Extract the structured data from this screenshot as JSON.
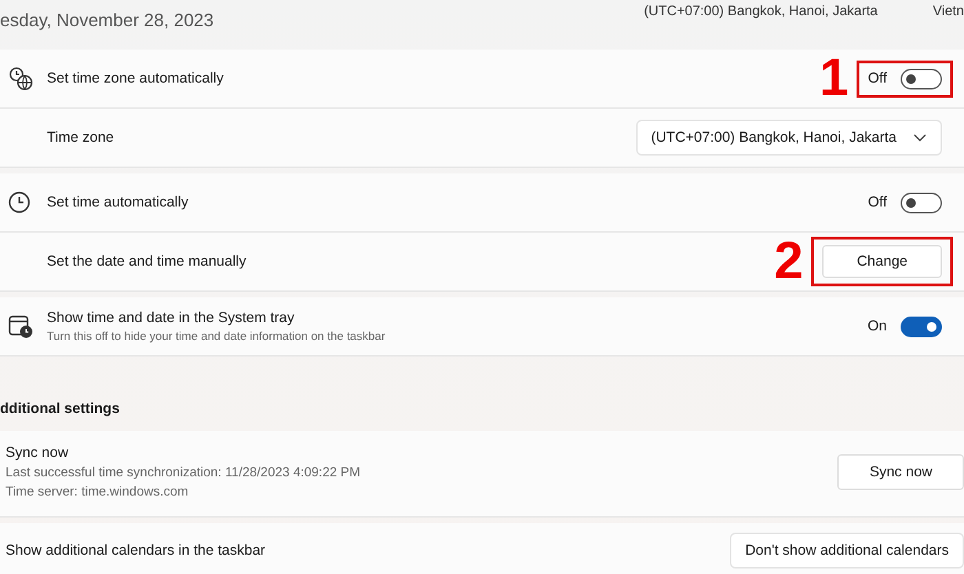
{
  "header": {
    "date": "esday, November 28, 2023",
    "timezone": "(UTC+07:00) Bangkok, Hanoi, Jakarta",
    "language": "Vietn"
  },
  "groups": [
    {
      "rows": [
        {
          "kind": "toggle",
          "label": "Set time zone automatically",
          "state_label": "Off",
          "on": false,
          "marker": "1"
        },
        {
          "kind": "dropdown",
          "label": "Time zone",
          "value": "(UTC+07:00) Bangkok, Hanoi, Jakarta"
        }
      ]
    },
    {
      "rows": [
        {
          "kind": "toggle",
          "label": "Set time automatically",
          "state_label": "Off",
          "on": false
        },
        {
          "kind": "button",
          "label": "Set the date and time manually",
          "button": "Change",
          "marker": "2"
        }
      ]
    },
    {
      "rows": [
        {
          "kind": "toggle",
          "label": "Show time and date in the System tray",
          "description": "Turn this off to hide your time and date information on the taskbar",
          "state_label": "On",
          "on": true
        }
      ]
    }
  ],
  "additional": {
    "title": "dditional settings",
    "sync": {
      "title": "Sync now",
      "lines": [
        "Last successful time synchronization: 11/28/2023 4:09:22 PM",
        "Time server: time.windows.com"
      ],
      "button": "Sync now"
    },
    "calendars": {
      "label": "Show additional calendars in the taskbar",
      "value": "Don't show additional calendars"
    }
  }
}
